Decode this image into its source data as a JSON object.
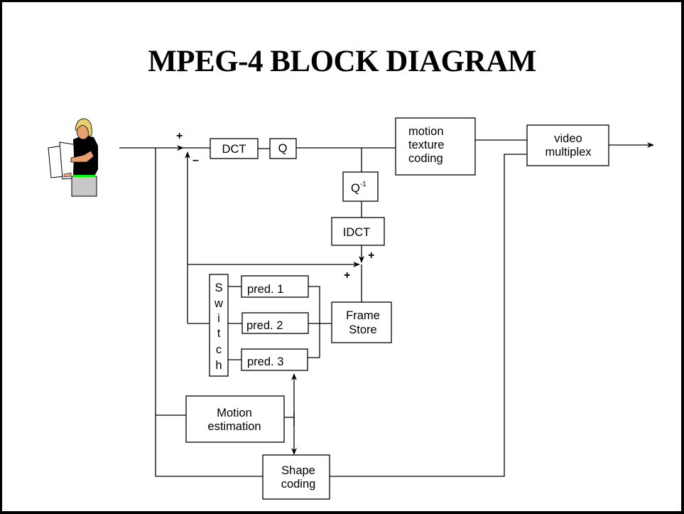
{
  "title": "MPEG-4 BLOCK DIAGRAM",
  "blocks": {
    "dct": "DCT",
    "q": "Q",
    "q_inverse_base": "Q",
    "q_inverse_exp": "-1",
    "idct": "IDCT",
    "motion_texture_coding": [
      "motion",
      "texture",
      "coding"
    ],
    "video_multiplex": [
      "video",
      "multiplex"
    ],
    "switch_letters": [
      "S",
      "w",
      "i",
      "t",
      "c",
      "h"
    ],
    "pred1": "pred. 1",
    "pred2": "pred. 2",
    "pred3": "pred. 3",
    "frame_store": [
      "Frame",
      "Store"
    ],
    "motion_estimation": [
      "Motion",
      "estimation"
    ],
    "shape_coding": [
      "Shape",
      "coding"
    ]
  },
  "signs": {
    "input_plus": "+",
    "input_minus": "–",
    "recon_plus_top": "+",
    "recon_plus_left": "+"
  },
  "clipart": {
    "name": "presenter-with-papers",
    "colors": {
      "hair": "#e8d070",
      "skin": "#e8a070",
      "shirt": "#000000",
      "belt": "#00ff00",
      "skirt": "#c8c8c8",
      "paper": "#ffffff"
    }
  }
}
